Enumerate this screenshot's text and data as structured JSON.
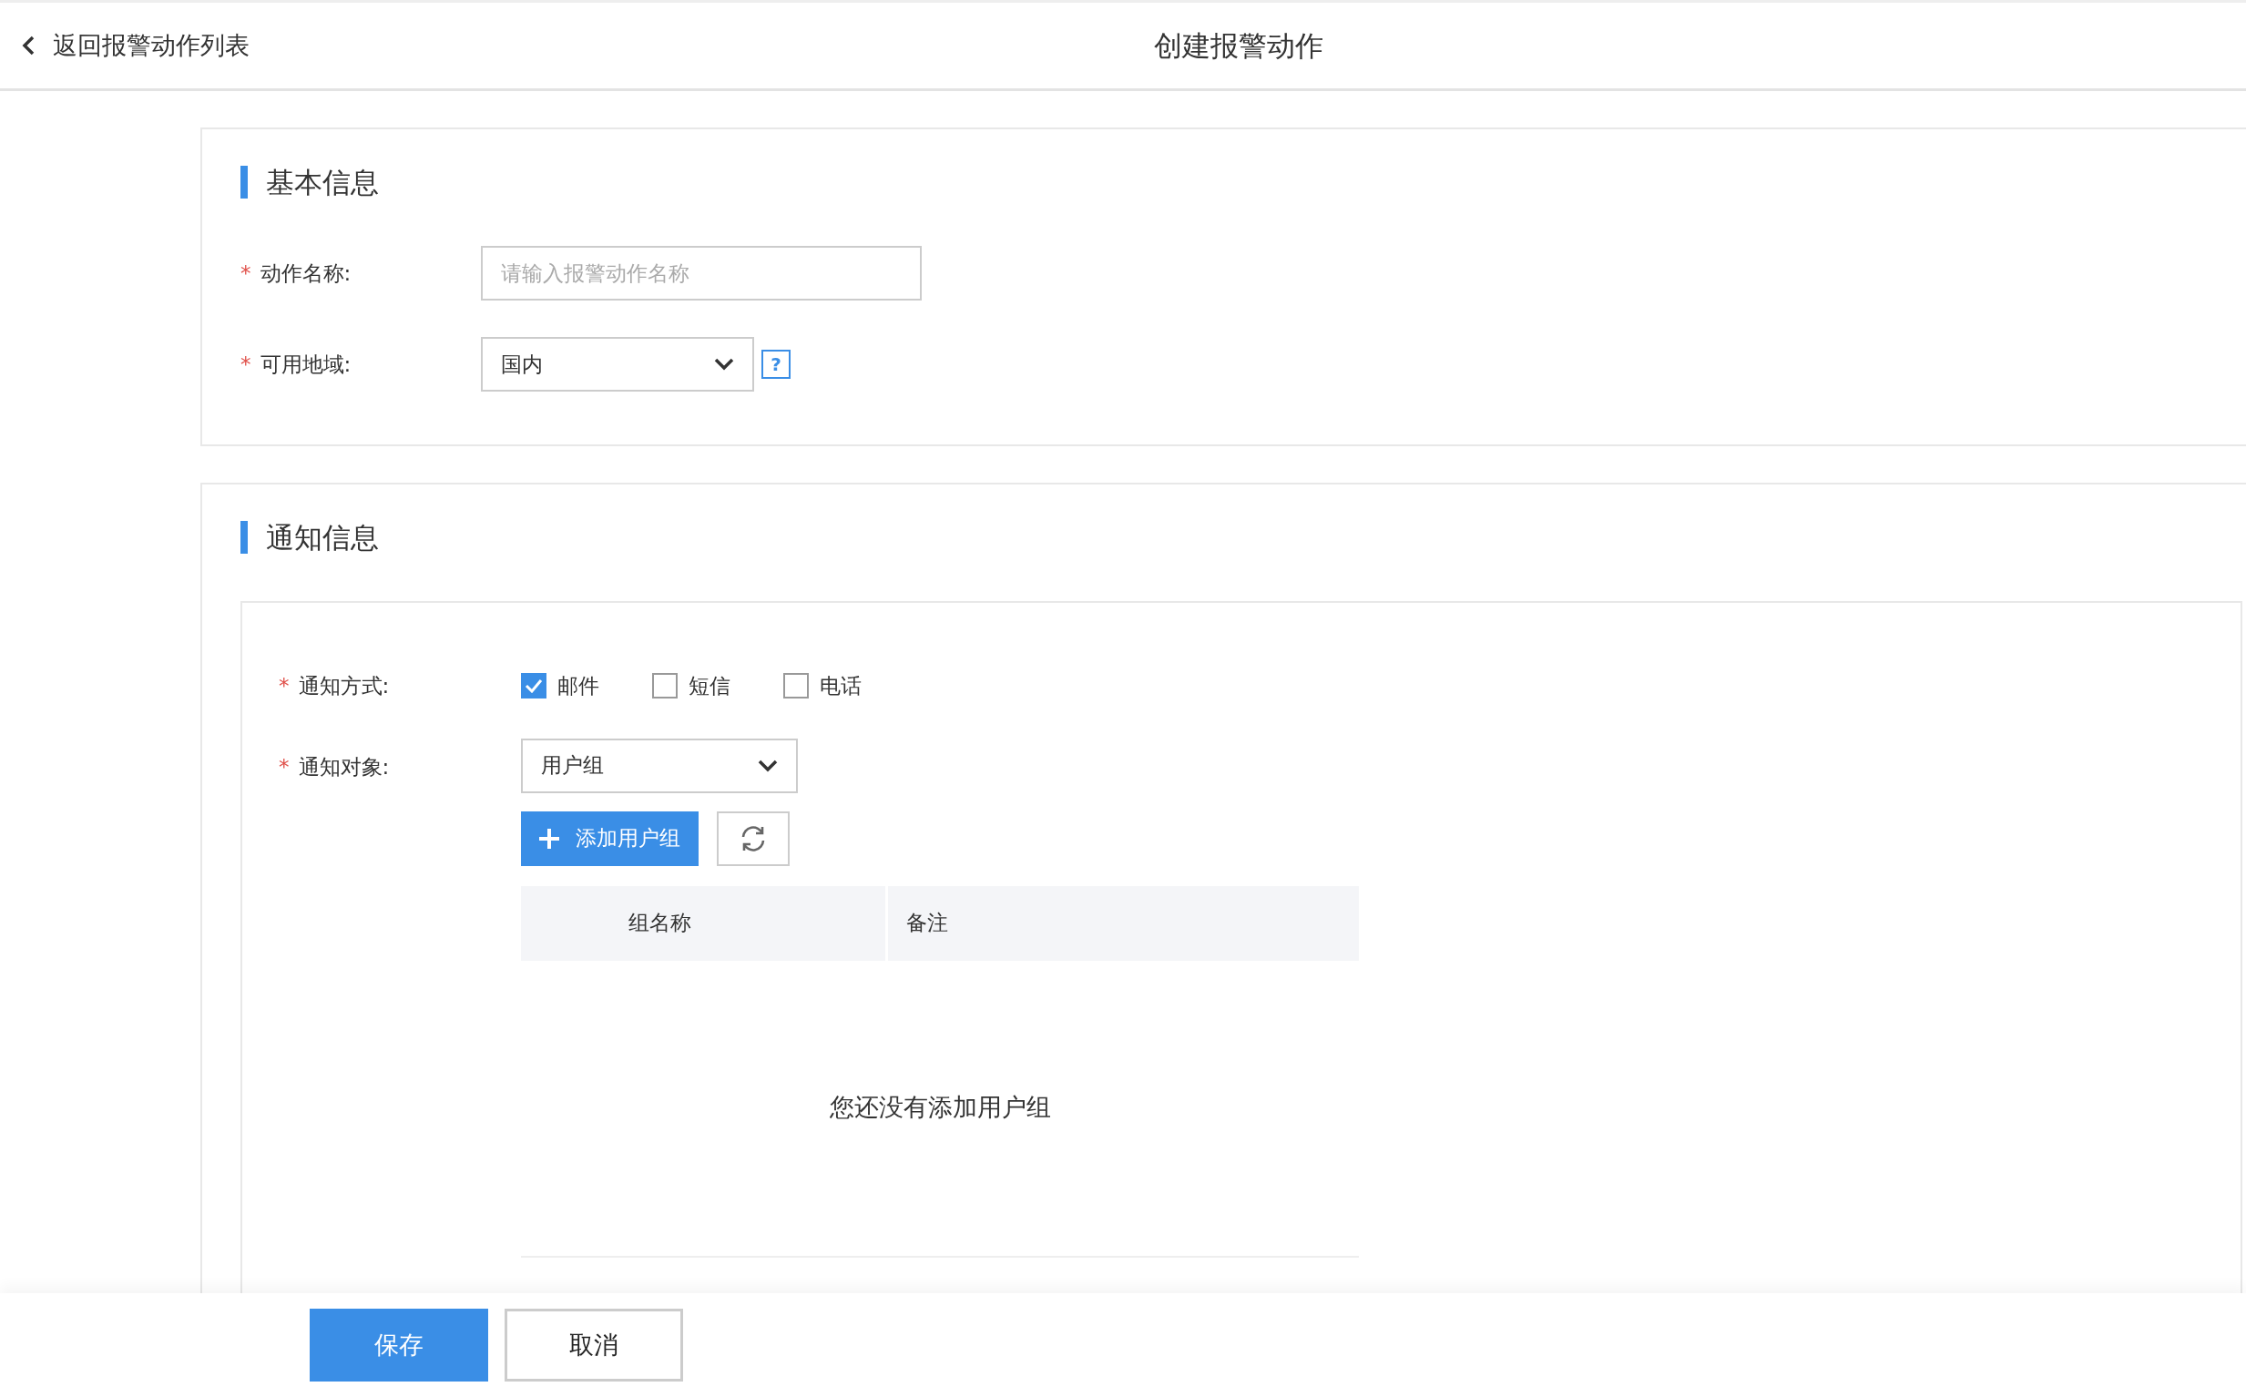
{
  "header": {
    "back_label": "返回报警动作列表",
    "title": "创建报警动作"
  },
  "basic": {
    "title": "基本信息",
    "name_field": {
      "label": "动作名称:",
      "required_mark": "*",
      "placeholder": "请输入报警动作名称"
    },
    "region_field": {
      "label": "可用地域:",
      "required_mark": "*",
      "value": "国内",
      "help": "?"
    }
  },
  "notify": {
    "title": "通知信息",
    "method": {
      "label": "通知方式:",
      "required_mark": "*",
      "options": [
        {
          "label": "邮件",
          "checked": true
        },
        {
          "label": "短信",
          "checked": false
        },
        {
          "label": "电话",
          "checked": false
        }
      ]
    },
    "target": {
      "label": "通知对象:",
      "required_mark": "*",
      "value": "用户组"
    },
    "add_button": "添加用户组",
    "table": {
      "columns": [
        "组名称",
        "备注"
      ],
      "empty_text": "您还没有添加用户组"
    }
  },
  "footer": {
    "save": "保存",
    "cancel": "取消"
  }
}
